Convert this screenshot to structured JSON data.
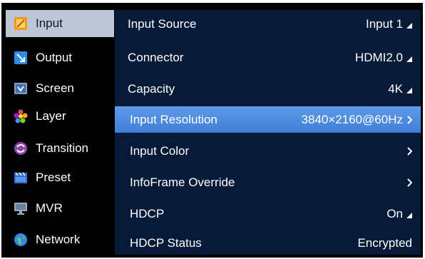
{
  "sidebar": {
    "items": [
      {
        "label": "Input",
        "icon": "input-icon"
      },
      {
        "label": "Output",
        "icon": "output-icon"
      },
      {
        "label": "Screen",
        "icon": "screen-icon"
      },
      {
        "label": "Layer",
        "icon": "layer-icon"
      },
      {
        "label": "Transition",
        "icon": "transition-icon"
      },
      {
        "label": "Preset",
        "icon": "preset-icon"
      },
      {
        "label": "MVR",
        "icon": "mvr-icon"
      },
      {
        "label": "Network",
        "icon": "network-icon"
      }
    ],
    "selected": "Input"
  },
  "settings": {
    "rows": [
      {
        "label": "Input Source",
        "value": "Input 1",
        "indicator": "dropdown-triangle"
      },
      {
        "label": "Connector",
        "value": "HDMI2.0",
        "indicator": "dropdown-triangle"
      },
      {
        "label": "Capacity",
        "value": "4K",
        "indicator": "dropdown-triangle"
      },
      {
        "label": "Input Resolution",
        "value": "3840×2160@60Hz",
        "indicator": "chevron-right"
      },
      {
        "label": "Input Color",
        "value": "",
        "indicator": "chevron-right"
      },
      {
        "label": "InfoFrame Override",
        "value": "",
        "indicator": "chevron-right"
      },
      {
        "label": "HDCP",
        "value": "On",
        "indicator": "dropdown-triangle"
      },
      {
        "label": "HDCP Status",
        "value": "Encrypted",
        "indicator": "none"
      }
    ],
    "selected": "Input Resolution"
  },
  "colors": {
    "frame_background": "#000000",
    "panel_background": "#071b38",
    "selected_row": "#4a8ae0",
    "selected_sidebar": "#bcc6d4"
  }
}
